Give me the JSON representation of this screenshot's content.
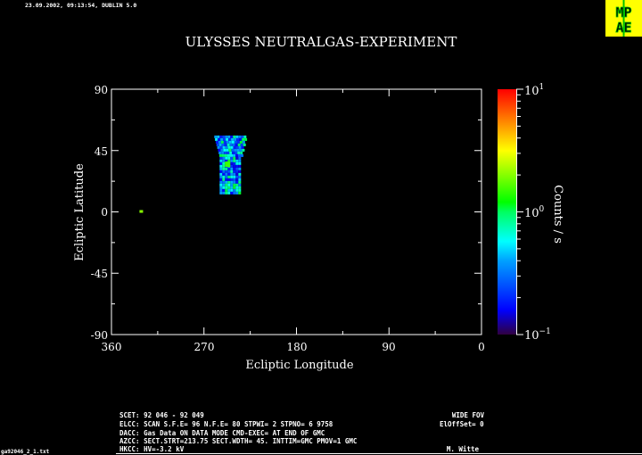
{
  "header": {
    "timestamp": "23.09.2002, 09:13:54, DUBLIN 5.0",
    "logo_text": "MPAE",
    "footer_file": "ga92046_2_1.txt"
  },
  "info": {
    "scet": "SCET: 92 046 - 92 049",
    "fov": "WIDE FOV",
    "elcc": "ELCC: SCAN  S.F.E= 96 N.F.E= 80 STPWI=  2  STPNO=  6   9758",
    "eloffset": "ElOffSet= 0",
    "dacc": "DACC: Gas Data ON    DATA MODE CMD-EXEC= AT END OF GMC",
    "azcc": "AZCC: SECT.STRT=213.75 SECT.WDTH= 45. INTTIM=GMC PMOV=1 GMC",
    "hkcc": "HKCC: HV=-3.2 kV",
    "author": "M. Witte"
  },
  "colors": {
    "background": "#000000",
    "axes": "#ffffff",
    "logo_bg": "#ffff00",
    "logo_fg": "#00c000"
  },
  "chart_data": {
    "type": "heatmap",
    "title": "ULYSSES NEUTRALGAS-EXPERIMENT",
    "xlabel": "Ecliptic Longitude",
    "ylabel": "Ecliptic Latitude",
    "xlim": [
      360,
      0
    ],
    "ylim": [
      -90,
      90
    ],
    "xticks": [
      "360",
      "270",
      "180",
      "90",
      "0"
    ],
    "yticks": [
      "90",
      "45",
      "0",
      "-45",
      "-90"
    ],
    "colorbar": {
      "label": "Counts / s",
      "scale": "log",
      "range": [
        0.1,
        10
      ],
      "ticks": [
        "10^1",
        "10^0",
        "10^-1"
      ]
    },
    "regions": [
      {
        "name": "scan field",
        "lon_range": [
          229,
          260
        ],
        "lat_top": 56,
        "lat_bottom": 13,
        "typical_counts": 0.4,
        "peak": {
          "lon": 247,
          "lat": 35,
          "counts": 1.5
        }
      },
      {
        "name": "isolated point",
        "lon": 331,
        "lat": 0,
        "counts": 2.0
      }
    ]
  }
}
